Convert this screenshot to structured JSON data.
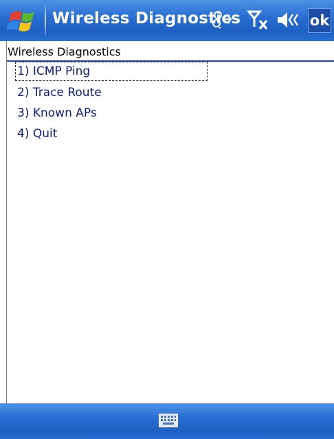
{
  "titlebar": {
    "title": "Wireless Diagnostics",
    "ok_label": "ok",
    "icons": [
      "start-flag-icon",
      "connectivity-icon",
      "signal-off-icon",
      "speaker-icon"
    ]
  },
  "form": {
    "heading": "Wireless Diagnostics",
    "menu_items": [
      {
        "label": "1) ICMP Ping",
        "focused": true
      },
      {
        "label": "2) Trace Route",
        "focused": false
      },
      {
        "label": "3) Known APs",
        "focused": false
      },
      {
        "label": "4) Quit",
        "focused": false
      }
    ]
  },
  "bottombar": {
    "icons": [
      "keyboard-icon"
    ]
  },
  "colors": {
    "bar_blue": "#2a6fd3",
    "menu_text": "#0b1f7a",
    "heading_rule": "#23409a"
  }
}
